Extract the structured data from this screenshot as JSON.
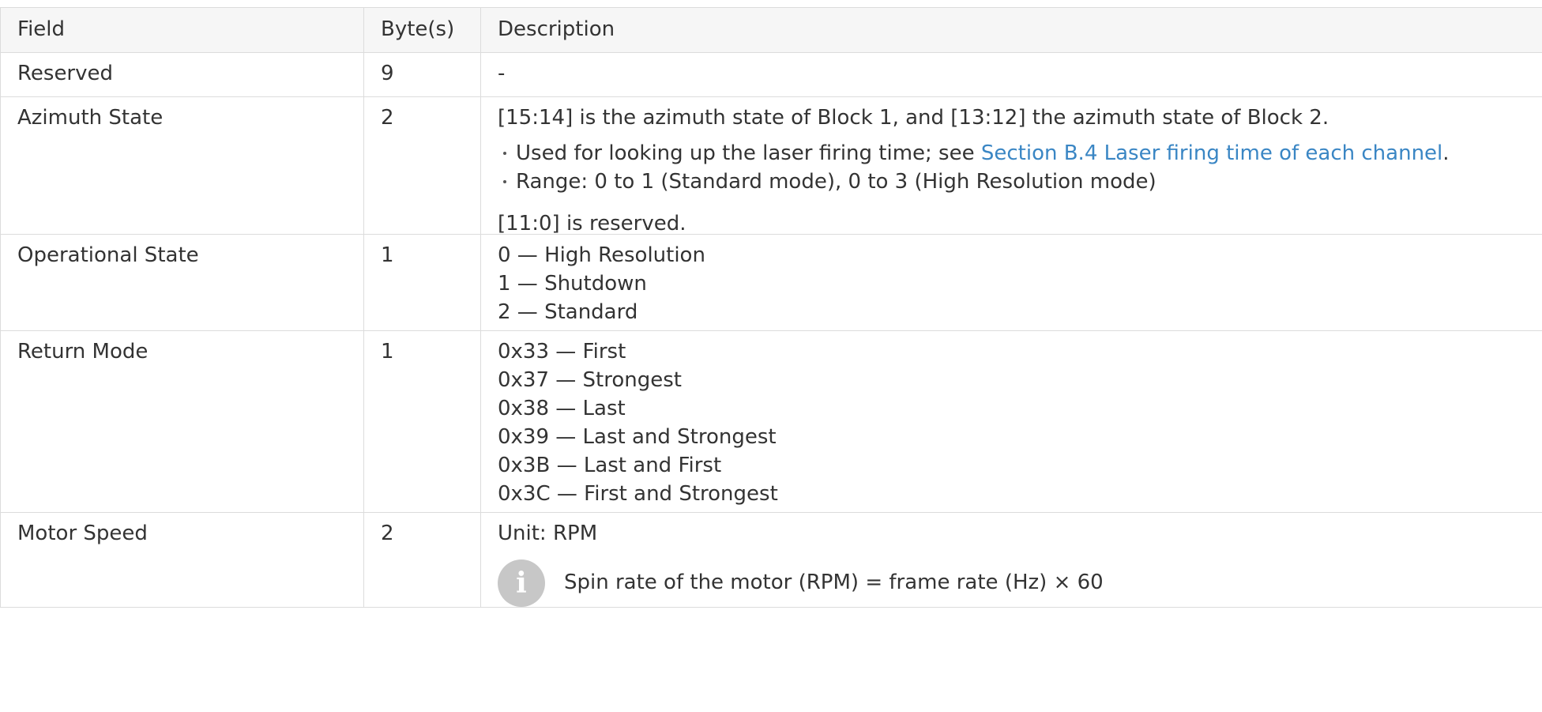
{
  "table": {
    "headers": [
      "Field",
      "Byte(s)",
      "Description"
    ],
    "rows": {
      "reserved": {
        "field": "Reserved",
        "bytes": "9",
        "desc": "-"
      },
      "azimuth": {
        "field": "Azimuth State",
        "bytes": "2",
        "desc_intro": "[15:14] is the azimuth state of Block 1, and [13:12] the azimuth state of Block 2.",
        "bullet1_prefix": "Used for looking up the laser firing time; see ",
        "bullet1_link": "Section B.4 Laser firing time of each channel",
        "bullet1_suffix": ".",
        "bullet2": "Range: 0 to 1 (Standard mode), 0 to 3 (High Resolution mode)",
        "desc_outro": "[11:0] is reserved."
      },
      "opstate": {
        "field": "Operational State",
        "bytes": "1",
        "values": [
          "0 — High Resolution",
          "1 — Shutdown",
          "2 — Standard"
        ]
      },
      "return": {
        "field": "Return Mode",
        "bytes": "1",
        "values": [
          "0x33 — First",
          "0x37 — Strongest",
          "0x38 — Last",
          "0x39 — Last and Strongest",
          "0x3B — Last and First",
          "0x3C — First and Strongest"
        ]
      },
      "motor": {
        "field": "Motor Speed",
        "bytes": "2",
        "unit": "Unit: RPM",
        "note": "Spin rate of the motor (RPM) = frame rate (Hz) × 60",
        "note_icon": "info-icon"
      }
    }
  }
}
